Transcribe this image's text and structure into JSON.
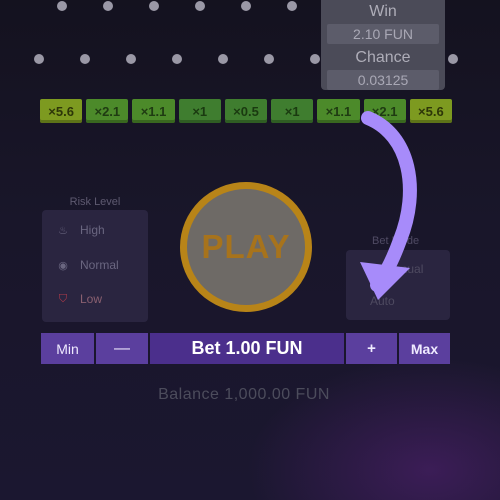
{
  "tooltip": {
    "win_label": "Win",
    "win_value": "2.10 FUN",
    "chance_label": "Chance",
    "chance_value": "0.03125"
  },
  "multipliers": [
    "×5.6",
    "×2.1",
    "×1.1",
    "×1",
    "×0.5",
    "×1",
    "×1.1",
    "×2.1",
    "×5.6"
  ],
  "risk": {
    "title": "Risk Level",
    "options": [
      "High",
      "Normal",
      "Low"
    ],
    "selected": "Low"
  },
  "play_label": "PLAY",
  "bet_mode": {
    "title": "Bet Mode",
    "options": [
      "Manual",
      "Auto"
    ]
  },
  "betbar": {
    "min_label": "Min",
    "decrease_label": "—",
    "bet_text": "Bet 1.00 FUN",
    "increase_label": "+",
    "max_label": "Max"
  },
  "balance_text": "Balance 1,000.00 FUN",
  "colors": {
    "bet_bar": "#5b3f9e",
    "arrow": "#a78bfa",
    "multiplier_green": "#4c8a2a",
    "play_ring": "#b88418"
  }
}
